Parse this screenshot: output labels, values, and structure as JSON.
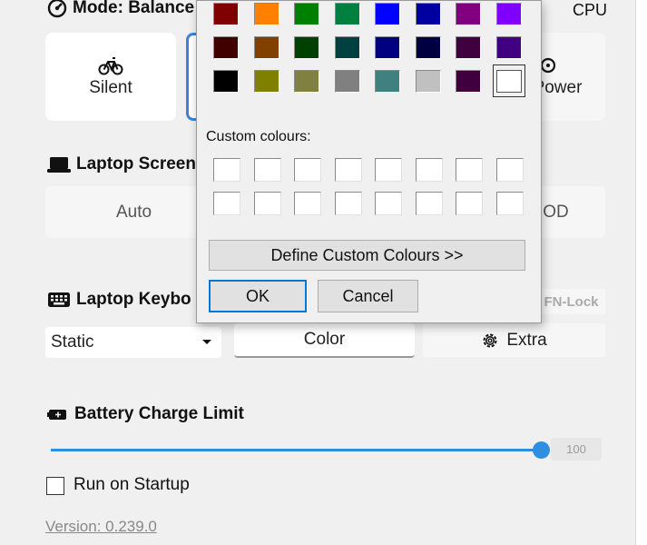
{
  "mode": {
    "label": "Mode: Balance",
    "right_label": "CPU"
  },
  "mode_tiles": [
    {
      "icon": "bike-icon",
      "label": "Silent"
    },
    {
      "icon": "turbo-icon",
      "label": "Power"
    }
  ],
  "screen": {
    "label": "Laptop Screen",
    "auto_label": "Auto",
    "right_label": "OD"
  },
  "keyboard": {
    "label": "Laptop Keybo",
    "mode_value": "Static",
    "color_label": "Color",
    "extra_label": "Extra",
    "fnlock_label": "FN-Lock"
  },
  "battery": {
    "label": "Battery Charge Limit",
    "value": "100",
    "fraction": 1.0
  },
  "startup": {
    "label": "Run on Startup",
    "checked": false
  },
  "version": "Version: 0.239.0",
  "dialog": {
    "basic_colors": [
      [
        "#800000",
        "#ff8000",
        "#008000",
        "#008040",
        "#0000ff",
        "#0000a0",
        "#800080",
        "#8000ff"
      ],
      [
        "#400000",
        "#804000",
        "#004000",
        "#004040",
        "#000080",
        "#000040",
        "#400040",
        "#400080"
      ],
      [
        "#000000",
        "#808000",
        "#808040",
        "#808080",
        "#408080",
        "#c0c0c0",
        "#400040",
        "#ffffff"
      ]
    ],
    "selected_color": "#ffffff",
    "custom_label": "Custom colours:",
    "define_label": "Define Custom Colours >>",
    "ok_label": "OK",
    "cancel_label": "Cancel"
  }
}
